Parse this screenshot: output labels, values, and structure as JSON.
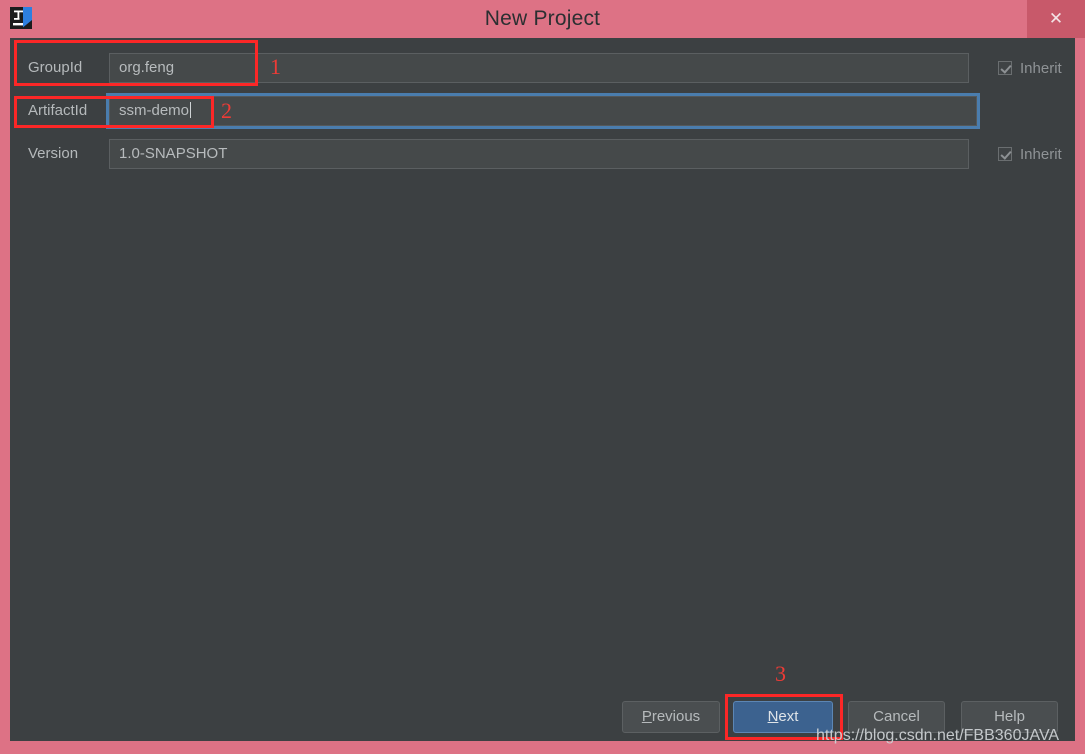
{
  "window": {
    "title": "New Project",
    "icon": "intellij-idea-icon",
    "close_label": "✕",
    "frame_color": "#dd7285",
    "content_color": "#3c4042",
    "close_bg": "#c8596a"
  },
  "form": {
    "rows": [
      {
        "id": "groupid",
        "label": "GroupId",
        "value": "org.feng",
        "placeholder": "GroupId",
        "focused": false,
        "inherit": {
          "label": "Inherit",
          "checked": true,
          "shown": true
        }
      },
      {
        "id": "artifactid",
        "label": "ArtifactId",
        "value": "ssm-demo",
        "placeholder": "ArtifactId",
        "focused": true,
        "inherit": {
          "label": "",
          "checked": false,
          "shown": false
        }
      },
      {
        "id": "version",
        "label": "Version",
        "value": "1.0-SNAPSHOT",
        "placeholder": "Version",
        "focused": false,
        "inherit": {
          "label": "Inherit",
          "checked": true,
          "shown": true
        }
      }
    ]
  },
  "annotations": {
    "accent_color": "#fc2727",
    "number_color": "#ee3b36",
    "items": [
      {
        "number": "1",
        "target": "groupid-row"
      },
      {
        "number": "2",
        "target": "artifactid-field"
      },
      {
        "number": "3",
        "target": "next-button"
      }
    ]
  },
  "buttons": {
    "previous": {
      "label": "Previous",
      "mnemonic": "P",
      "primary": false
    },
    "next": {
      "label": "Next",
      "mnemonic": "N",
      "primary": true
    },
    "cancel": {
      "label": "Cancel",
      "mnemonic": "",
      "primary": false
    },
    "help": {
      "label": "Help",
      "mnemonic": "",
      "primary": false
    }
  },
  "watermark": {
    "text": "https://blog.csdn.net/FBB360JAVA"
  }
}
